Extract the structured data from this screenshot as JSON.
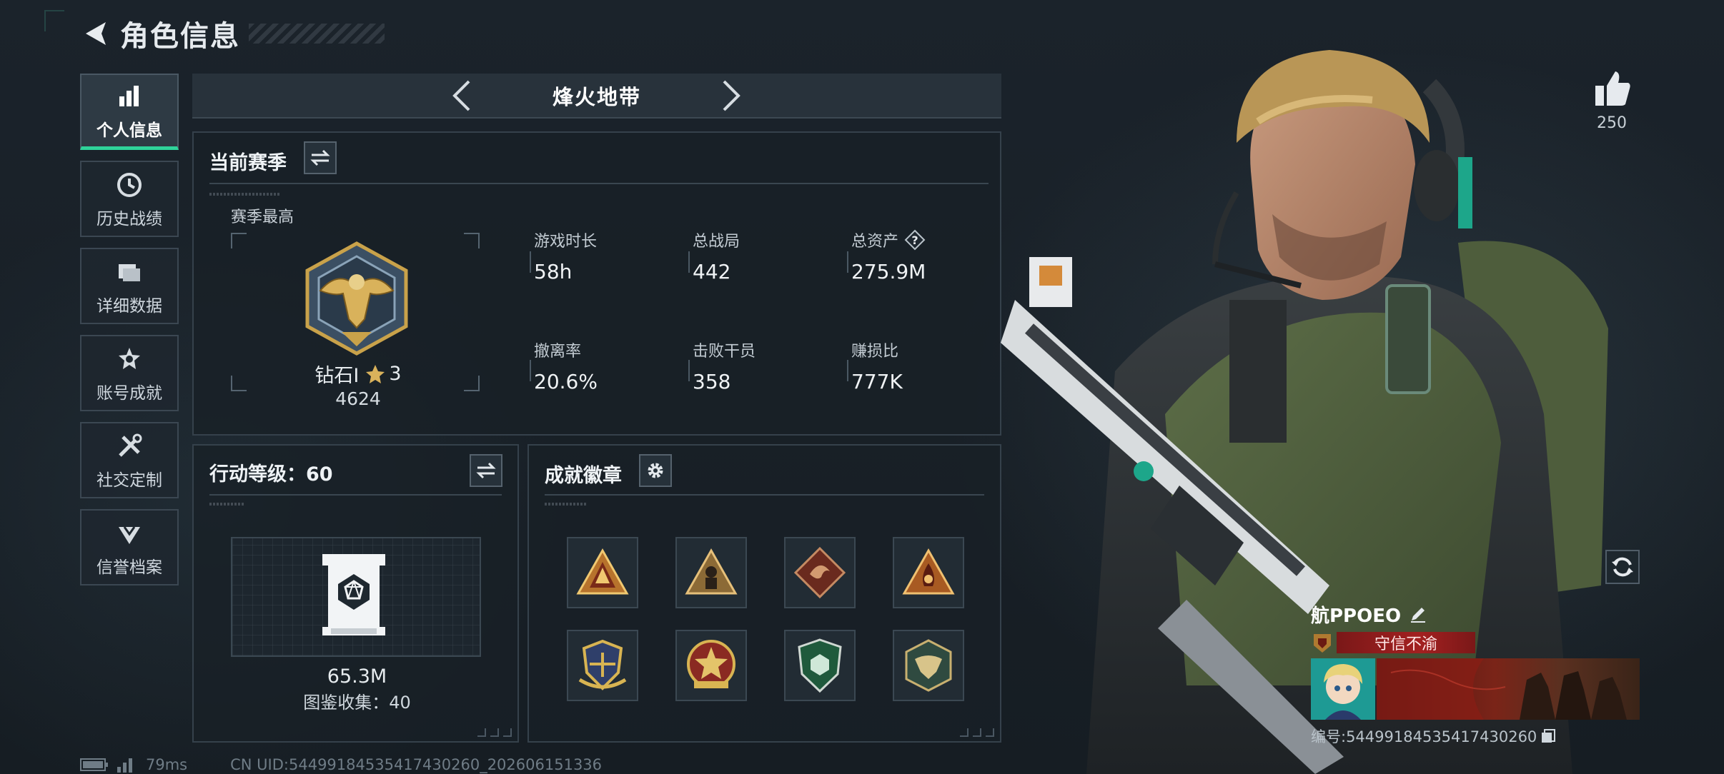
{
  "header": {
    "title": "角色信息"
  },
  "sidebar": {
    "items": [
      {
        "label": "个人信息"
      },
      {
        "label": "历史战绩"
      },
      {
        "label": "详细数据"
      },
      {
        "label": "账号成就"
      },
      {
        "label": "社交定制"
      },
      {
        "label": "信誉档案"
      }
    ]
  },
  "mode": {
    "name": "烽火地带"
  },
  "season": {
    "title": "当前赛季",
    "best_label": "赛季最高",
    "rank_name": "钻石Ⅰ",
    "rank_stars": "3",
    "rank_score": "4624",
    "stats": [
      {
        "label": "游戏时长",
        "value": "58h"
      },
      {
        "label": "总战局",
        "value": "442"
      },
      {
        "label": "总资产",
        "value": "275.9M"
      },
      {
        "label": "撤离率",
        "value": "20.6%"
      },
      {
        "label": "击败干员",
        "value": "358"
      },
      {
        "label": "赚损比",
        "value": "777K"
      }
    ]
  },
  "level": {
    "title": "行动等级：60",
    "value": "65.3M",
    "album_count": "图鉴收集：40"
  },
  "badges": {
    "title": "成就徽章",
    "items": [
      {
        "icon": "triangle-gold-badge-icon"
      },
      {
        "icon": "triangle-soldier-badge-icon"
      },
      {
        "icon": "dragon-diamond-badge-icon"
      },
      {
        "icon": "triangle-flame-badge-icon"
      },
      {
        "icon": "winged-shield-badge-icon"
      },
      {
        "icon": "star-medal-badge-icon"
      },
      {
        "icon": "green-shield-badge-icon"
      },
      {
        "icon": "eagle-hexagon-badge-icon"
      }
    ]
  },
  "profile": {
    "likes": "250",
    "player_name": "航PPOEO",
    "player_title": "守信不渝",
    "player_id": "编号:544991845354174302​60"
  },
  "footer": {
    "ping": "79ms",
    "uid": "CN UID:544991845354174302​60_202606151336"
  },
  "colors": {
    "accent_green": "#2fd39a",
    "title_red": "#a32020",
    "gold": "#c9a24a"
  }
}
